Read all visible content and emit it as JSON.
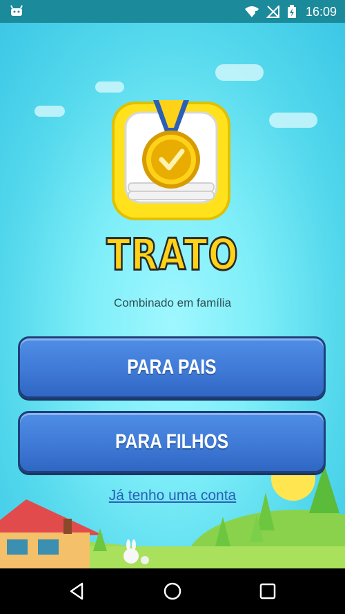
{
  "status_bar": {
    "time": "16:09"
  },
  "logo": {
    "icon": "medal-checkmark-icon"
  },
  "app": {
    "title": "TRATO",
    "subtitle": "Combinado em família"
  },
  "buttons": {
    "parents": "PARA PAIS",
    "children": "PARA FILHOS"
  },
  "link": {
    "login": "Já tenho uma conta"
  },
  "colors": {
    "accent": "#ffd21a",
    "button": "#3f7ad6",
    "link": "#2b5fb5",
    "sky": "#52d7ec"
  },
  "navigation": {
    "back": "back-icon",
    "home": "home-icon",
    "recents": "recents-icon"
  }
}
